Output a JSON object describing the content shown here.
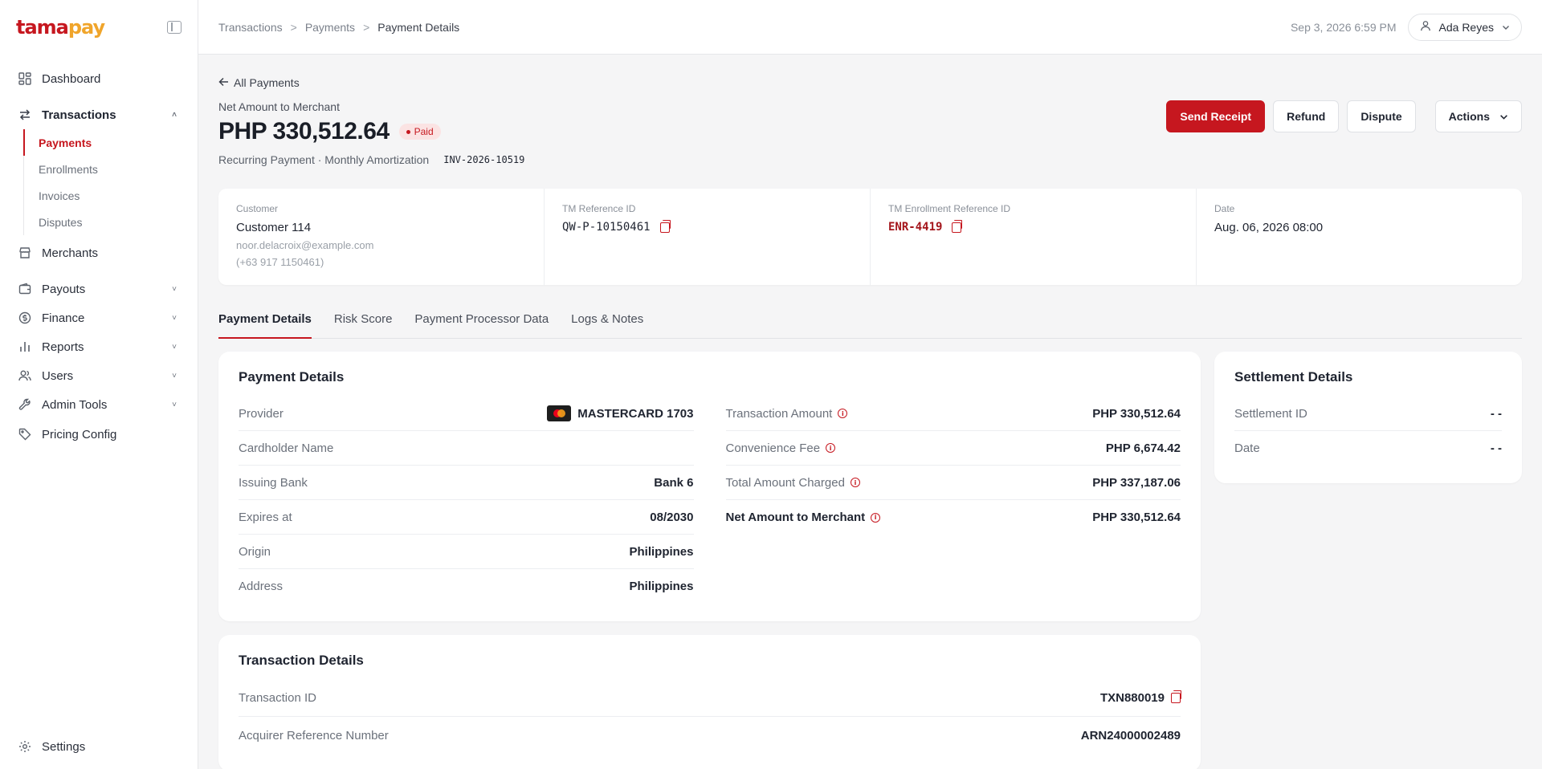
{
  "brand": {
    "logo_part1": "tama",
    "logo_part2": "pay"
  },
  "sidebar": {
    "items": [
      {
        "label": "Dashboard"
      },
      {
        "label": "Transactions"
      },
      {
        "label": "Merchants"
      },
      {
        "label": "Payouts"
      },
      {
        "label": "Finance"
      },
      {
        "label": "Reports"
      },
      {
        "label": "Users"
      },
      {
        "label": "Admin Tools"
      },
      {
        "label": "Pricing Config"
      }
    ],
    "transactions_sub": [
      "Payments",
      "Enrollments",
      "Invoices",
      "Disputes"
    ],
    "settings": "Settings"
  },
  "topbar": {
    "breadcrumbs": [
      "Transactions",
      "Payments",
      "Payment Details"
    ],
    "datetime": "Sep 3, 2026 6:59 PM",
    "user_name": "Ada Reyes"
  },
  "header": {
    "back_label": "All Payments",
    "net_label": "Net Amount to Merchant",
    "amount": "PHP 330,512.64",
    "status": "Paid",
    "subline": "Recurring Payment · Monthly Amortization",
    "invoice": "INV-2026-10519",
    "buttons": {
      "send_receipt": "Send Receipt",
      "refund": "Refund",
      "dispute": "Dispute",
      "actions": "Actions"
    }
  },
  "info": {
    "customer_label": "Customer",
    "customer_name": "Customer 114",
    "customer_email": "noor.delacroix@example.com",
    "customer_phone": "(+63 917 1150461)",
    "ref_label": "TM Reference ID",
    "ref_value": "QW-P-10150461",
    "enroll_label": "TM Enrollment Reference ID",
    "enroll_value": "ENR-4419",
    "date_label": "Date",
    "date_value": "Aug. 06, 2026 08:00"
  },
  "tabs": [
    "Payment Details",
    "Risk Score",
    "Payment Processor Data",
    "Logs & Notes"
  ],
  "payment_details": {
    "title": "Payment Details",
    "left": [
      {
        "k": "Provider",
        "v": "MASTERCARD 1703"
      },
      {
        "k": "Cardholder Name",
        "v": ""
      },
      {
        "k": "Issuing Bank",
        "v": "Bank 6"
      },
      {
        "k": "Expires at",
        "v": "08/2030"
      },
      {
        "k": "Origin",
        "v": "Philippines"
      },
      {
        "k": "Address",
        "v": "Philippines"
      }
    ],
    "right": [
      {
        "k": "Transaction Amount",
        "v": "PHP 330,512.64"
      },
      {
        "k": "Convenience Fee",
        "v": "PHP 6,674.42"
      },
      {
        "k": "Total Amount Charged",
        "v": "PHP 337,187.06"
      },
      {
        "k": "Net Amount to Merchant",
        "v": "PHP 330,512.64"
      }
    ]
  },
  "settlement": {
    "title": "Settlement Details",
    "rows": [
      {
        "k": "Settlement ID",
        "v": "- -"
      },
      {
        "k": "Date",
        "v": "- -"
      }
    ]
  },
  "transaction_details": {
    "title": "Transaction Details",
    "rows": [
      {
        "k": "Transaction ID",
        "v": "TXN880019"
      },
      {
        "k": "Acquirer Reference Number",
        "v": "ARN24000002489"
      }
    ]
  },
  "colors": {
    "accent": "#c6171f",
    "logo_secondary": "#f0a52b"
  }
}
